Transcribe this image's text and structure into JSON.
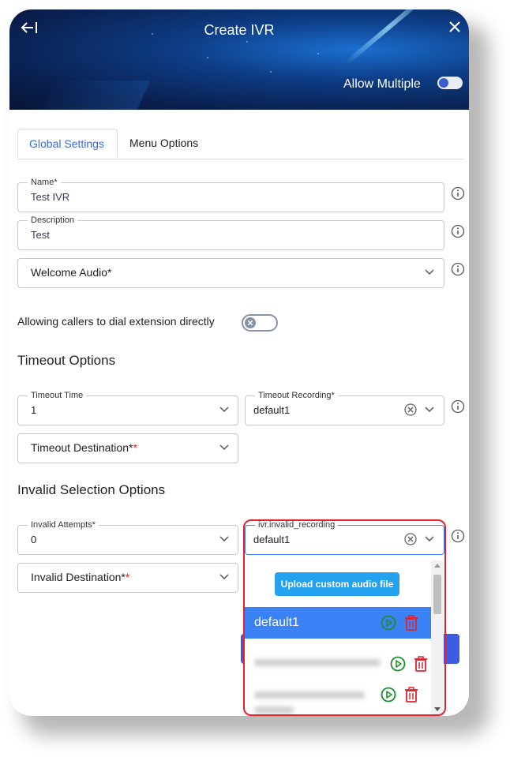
{
  "header": {
    "title": "Create IVR",
    "allow_multiple_label": "Allow Multiple",
    "allow_multiple_on": false
  },
  "tabs": [
    {
      "label": "Global Settings",
      "active": true
    },
    {
      "label": "Menu Options",
      "active": false
    }
  ],
  "fields": {
    "name": {
      "label": "Name*",
      "value": "Test IVR"
    },
    "description": {
      "label": "Description",
      "value": "Test"
    },
    "welcome_audio": {
      "placeholder": "Welcome Audio*"
    }
  },
  "dial_extension": {
    "label": "Allowing callers to dial extension directly",
    "on": false
  },
  "timeout": {
    "title": "Timeout Options",
    "time": {
      "label": "Timeout Time",
      "value": "1"
    },
    "recording": {
      "label": "Timeout Recording*",
      "value": "default1"
    },
    "destination": {
      "placeholder": "Timeout Destination*",
      "required_mark": "*"
    }
  },
  "invalid": {
    "title": "Invalid Selection Options",
    "attempts": {
      "label": "Invalid Attempts*",
      "value": "0"
    },
    "recording": {
      "label": "ivr.invalid_recording",
      "value": "default1"
    },
    "destination": {
      "placeholder": "Invalid Destination*",
      "required_mark": "*"
    }
  },
  "dropdown": {
    "upload_label": "Upload custom audio file",
    "selected_option": "default1"
  },
  "colors": {
    "accent": "#3b82f6",
    "tab_active": "#3b6ad6",
    "upload": "#24a2f0",
    "play": "#1a8f2c",
    "delete": "#e0242e",
    "highlight": "#e8202e"
  }
}
